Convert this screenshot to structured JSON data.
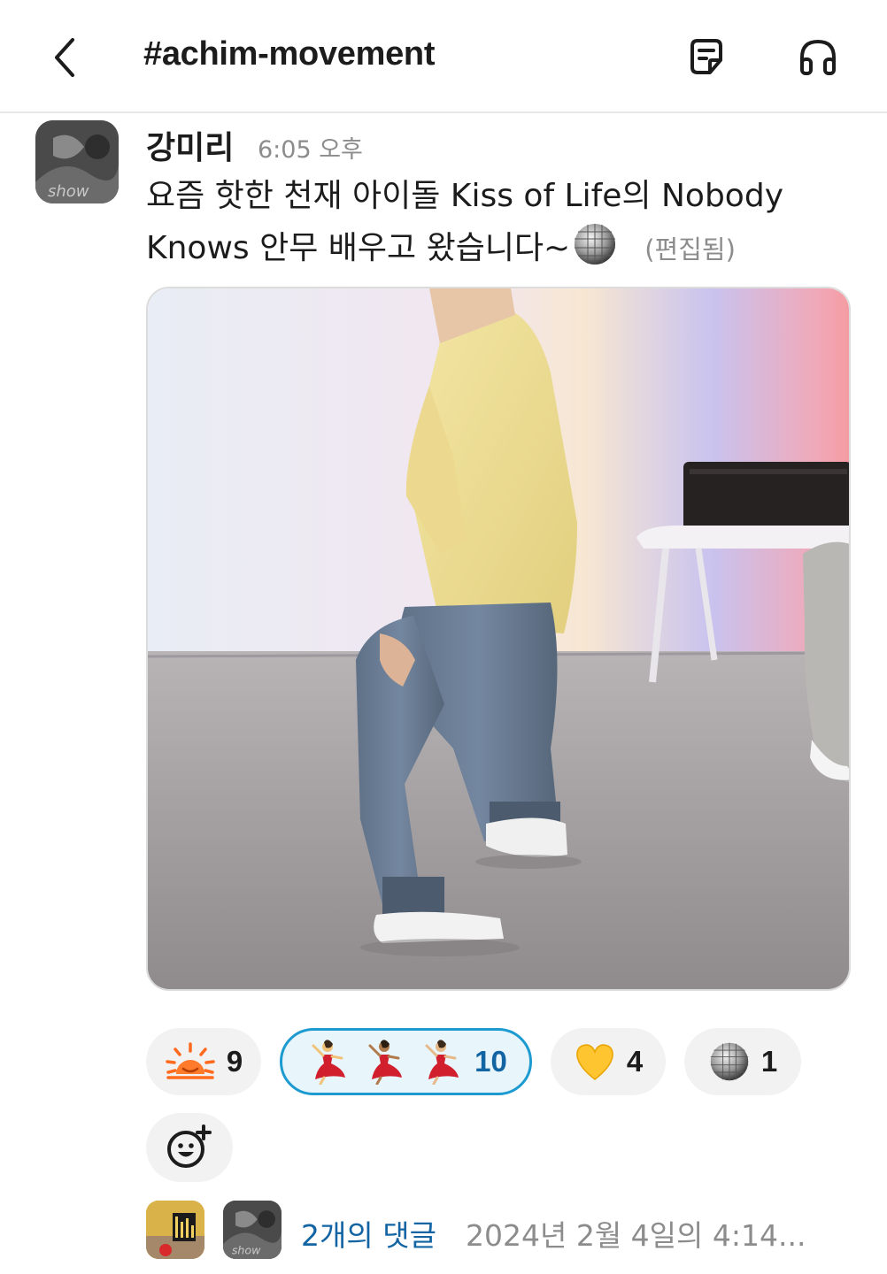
{
  "header": {
    "channel": "#achim-movement"
  },
  "message": {
    "author": "강미리",
    "time": "6:05 오후",
    "text": "요즘 핫한 천재 아이돌 Kiss of Life의 Nobody Knows 안무 배우고 왔습니다~",
    "edited": "(편집됨)"
  },
  "reactions": [
    {
      "emoji": "sunrise-icon",
      "count": "9",
      "active": false
    },
    {
      "emoji": "dancer-icon",
      "count": "10",
      "active": true
    },
    {
      "emoji": "yellow-heart-icon",
      "count": "4",
      "active": false
    },
    {
      "emoji": "disco-ball-icon",
      "count": "1",
      "active": false
    }
  ],
  "thread": {
    "replies": "2개의 댓글",
    "last_reply": "2024년 2월 4일의 4:14..."
  },
  "colors": {
    "link": "#1264a3",
    "active_border": "#1d9bd1",
    "muted": "#8c8c8c"
  }
}
